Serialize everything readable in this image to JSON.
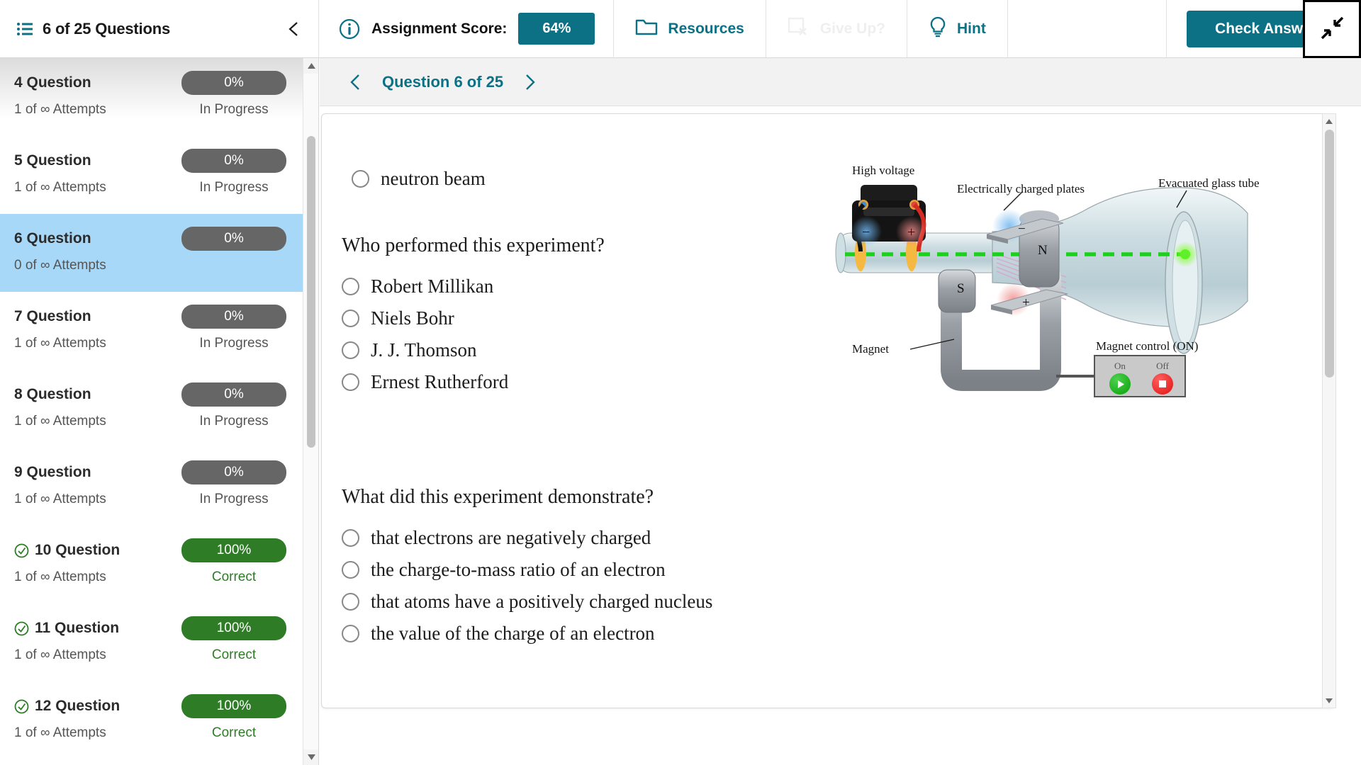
{
  "topbar": {
    "list_icon": "list-icon",
    "question_count": "6 of 25 Questions",
    "collapse_icon": "chevron-left-icon",
    "info_icon": "info-circle-icon",
    "score_label": "Assignment Score:",
    "score_value": "64%",
    "resources_label": "Resources",
    "resources_icon": "folder-icon",
    "give_up_label": "Give Up?",
    "give_up_icon": "square-x-icon",
    "hint_label": "Hint",
    "hint_icon": "lightbulb-icon",
    "check_answer_label": "Check Answer",
    "expand_icon": "collapse-arrows-icon",
    "accent_color": "#0d7186"
  },
  "sidebar": {
    "scroll_up_icon": "triangle-up-icon",
    "scroll_down_icon": "triangle-down-icon",
    "questions": [
      {
        "title": "4 Question",
        "attempts": "1 of ∞ Attempts",
        "score": "0%",
        "status": "In Progress",
        "correct": false,
        "selected": false
      },
      {
        "title": "5 Question",
        "attempts": "1 of ∞ Attempts",
        "score": "0%",
        "status": "In Progress",
        "correct": false,
        "selected": false
      },
      {
        "title": "6 Question",
        "attempts": "0 of ∞ Attempts",
        "score": "0%",
        "status": "",
        "correct": false,
        "selected": true
      },
      {
        "title": "7 Question",
        "attempts": "1 of ∞ Attempts",
        "score": "0%",
        "status": "In Progress",
        "correct": false,
        "selected": false
      },
      {
        "title": "8 Question",
        "attempts": "1 of ∞ Attempts",
        "score": "0%",
        "status": "In Progress",
        "correct": false,
        "selected": false
      },
      {
        "title": "9 Question",
        "attempts": "1 of ∞ Attempts",
        "score": "0%",
        "status": "In Progress",
        "correct": false,
        "selected": false
      },
      {
        "title": "10 Question",
        "attempts": "1 of ∞ Attempts",
        "score": "100%",
        "status": "Correct",
        "correct": true,
        "selected": false
      },
      {
        "title": "11 Question",
        "attempts": "1 of ∞ Attempts",
        "score": "100%",
        "status": "Correct",
        "correct": true,
        "selected": false
      },
      {
        "title": "12 Question",
        "attempts": "1 of ∞ Attempts",
        "score": "100%",
        "status": "Correct",
        "correct": true,
        "selected": false
      }
    ]
  },
  "main": {
    "prev_icon": "chevron-left-icon",
    "next_icon": "chevron-right-icon",
    "question_nav_label": "Question 6 of 25",
    "scroll_up_icon": "triangle-up-icon",
    "scroll_down_icon": "triangle-down-icon",
    "partial_option_top": "neutron beam",
    "parts": [
      {
        "prompt": "Who performed this experiment?",
        "options": [
          "Robert Millikan",
          "Niels Bohr",
          "J. J. Thomson",
          "Ernest Rutherford"
        ]
      },
      {
        "prompt": "What did this experiment demonstrate?",
        "options": [
          "that electrons are negatively charged",
          "the charge-to-mass ratio of an electron",
          "that atoms have a positively charged nucleus",
          "the value of the charge of an electron"
        ]
      }
    ]
  },
  "diagram": {
    "labels": {
      "high_voltage": "High voltage",
      "charged_plates": "Electrically charged plates",
      "evacuated_tube": "Evacuated glass tube",
      "magnet": "Magnet",
      "pole_north": "N",
      "pole_south": "S",
      "plate_negative": "−",
      "plate_positive": "+",
      "terminal_negative": "−",
      "terminal_positive": "+",
      "magnet_control": "Magnet control (ON)",
      "on": "On",
      "off": "Off"
    }
  }
}
